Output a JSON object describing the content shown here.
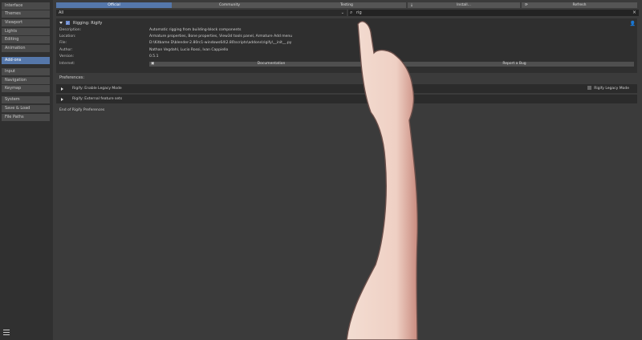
{
  "sidebar": {
    "items": [
      {
        "label": "Interface"
      },
      {
        "label": "Themes"
      },
      {
        "label": "Viewport"
      },
      {
        "label": "Lights"
      },
      {
        "label": "Editing"
      },
      {
        "label": "Animation"
      },
      {
        "label": "Add-ons"
      },
      {
        "label": "Input"
      },
      {
        "label": "Navigation"
      },
      {
        "label": "Keymap"
      },
      {
        "label": "System"
      },
      {
        "label": "Save & Load"
      },
      {
        "label": "File Paths"
      }
    ]
  },
  "tabs": {
    "official": "Official",
    "community": "Community",
    "testing": "Testing"
  },
  "toolbar": {
    "install": "Install...",
    "refresh": "Refresh"
  },
  "filter": {
    "value": "All"
  },
  "search": {
    "value": "rig"
  },
  "addon": {
    "name": "Rigging: Rigify",
    "details": [
      {
        "key": "Description:",
        "value": "Automatic rigging from building-block components"
      },
      {
        "key": "Location:",
        "value": "Armature properties, Bone properties, View3d tools panel, Armature Add menu"
      },
      {
        "key": "File:",
        "value": "D:\\Kitbame D\\blender-2.80rc1-windows64\\2.80\\scripts\\addons\\rigify\\__init__.py"
      },
      {
        "key": "Author:",
        "value": "Nathan Vegdahl, Lucio Rossi, Ivan Cappiello"
      },
      {
        "key": "Version:",
        "value": "0.5.1"
      },
      {
        "key": "Internet:",
        "value": ""
      }
    ],
    "documentation": "Documentation",
    "report_bug": "Report a Bug"
  },
  "preferences": {
    "title": "Preferences:",
    "legacy_row": "Rigify: Enable Legacy Mode",
    "legacy_checkbox": "Rigify Legacy Mode",
    "external_row": "Rigify: External feature sets",
    "end": "End of Rigify Preferences"
  },
  "colors": {
    "accent": "#5577aa",
    "skin": "#f0d8cc",
    "background": "#3b3b3b"
  }
}
